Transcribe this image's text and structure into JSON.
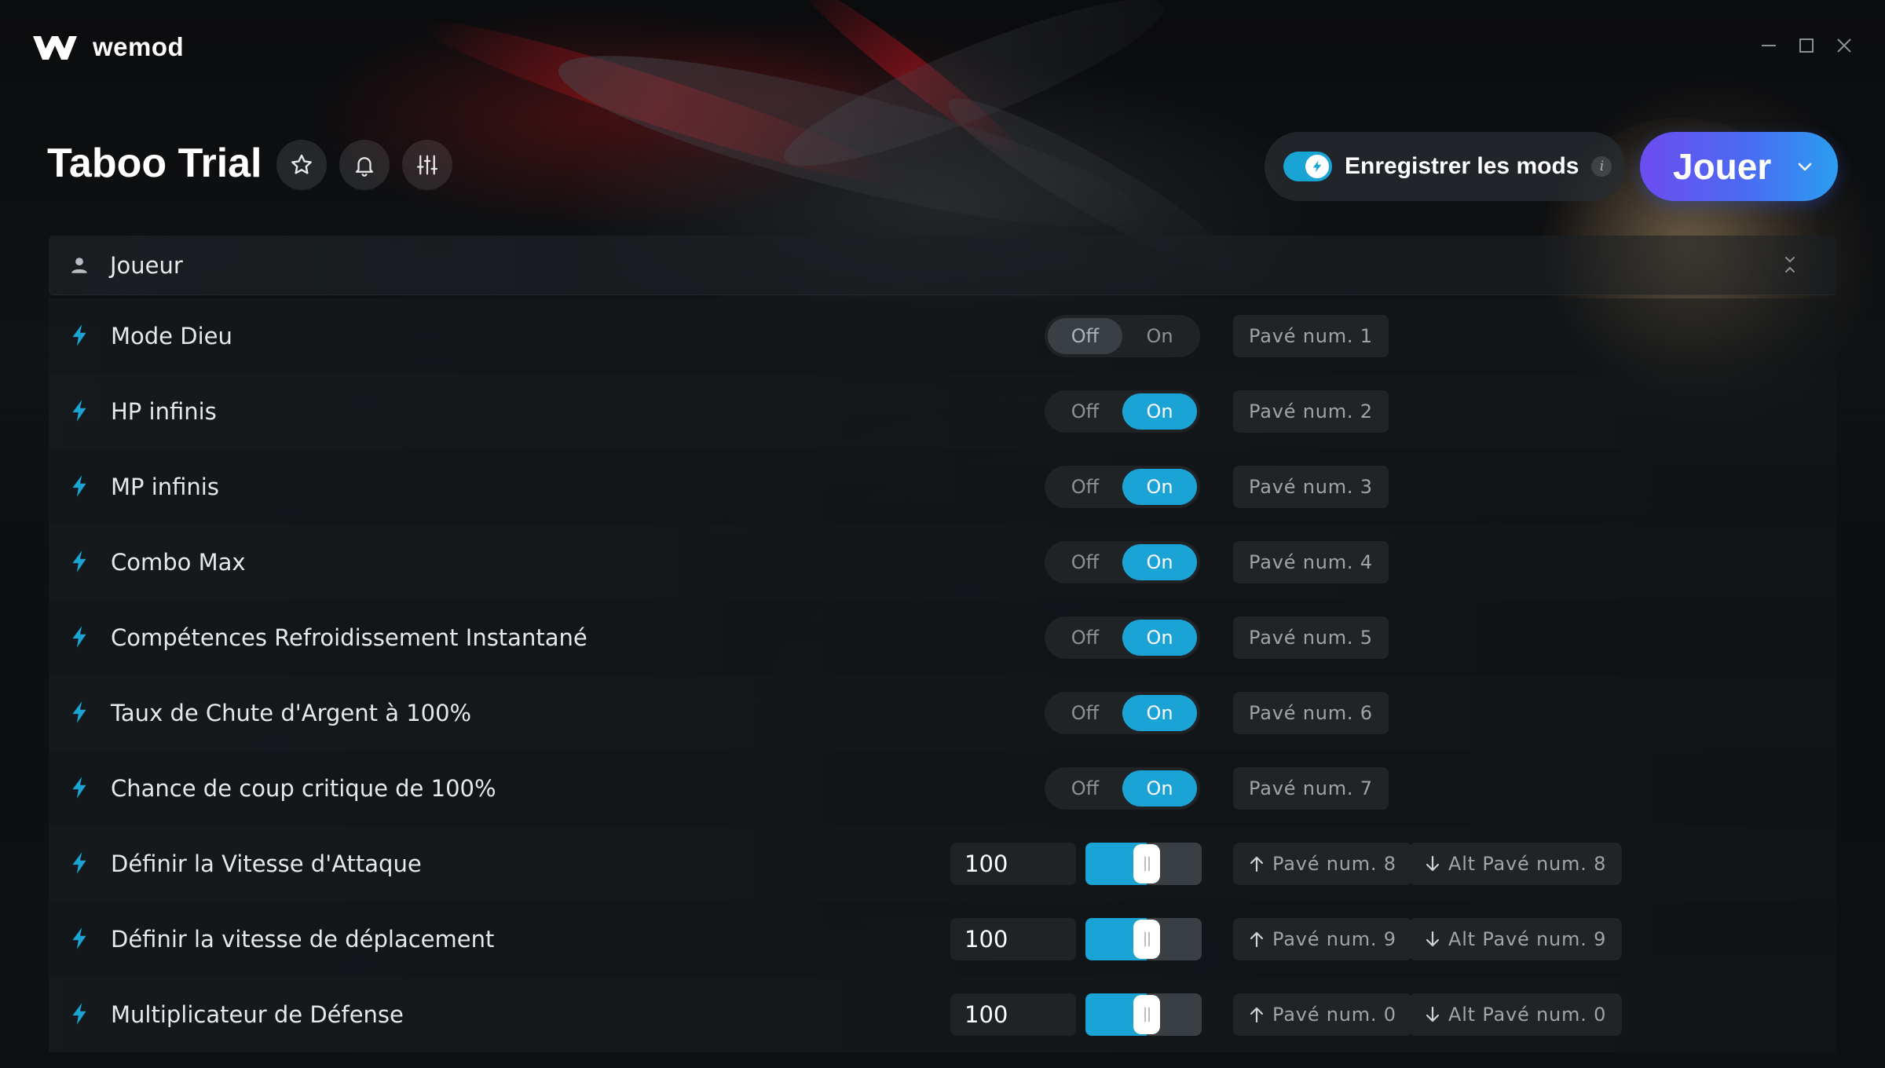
{
  "app": {
    "name": "wemod"
  },
  "header": {
    "game_title": "Taboo Trial",
    "save_mods_label": "Enregistrer les mods",
    "save_mods_enabled": true,
    "info_glyph": "i",
    "play_label": "Jouer"
  },
  "category": {
    "label": "Joueur",
    "icon": "person-icon"
  },
  "mods": [
    {
      "label": "Mode Dieu",
      "type": "toggle",
      "state": "Off",
      "off_label": "Off",
      "on_label": "On",
      "hotkey": "Pavé num. 1"
    },
    {
      "label": "HP infinis",
      "type": "toggle",
      "state": "On",
      "off_label": "Off",
      "on_label": "On",
      "hotkey": "Pavé num. 2"
    },
    {
      "label": "MP infinis",
      "type": "toggle",
      "state": "On",
      "off_label": "Off",
      "on_label": "On",
      "hotkey": "Pavé num. 3"
    },
    {
      "label": "Combo Max",
      "type": "toggle",
      "state": "On",
      "off_label": "Off",
      "on_label": "On",
      "hotkey": "Pavé num. 4"
    },
    {
      "label": "Compétences Refroidissement Instantané",
      "type": "toggle",
      "state": "On",
      "off_label": "Off",
      "on_label": "On",
      "hotkey": "Pavé num. 5"
    },
    {
      "label": "Taux de Chute d'Argent à 100%",
      "type": "toggle",
      "state": "On",
      "off_label": "Off",
      "on_label": "On",
      "hotkey": "Pavé num. 6"
    },
    {
      "label": "Chance de coup critique de 100%",
      "type": "toggle",
      "state": "On",
      "off_label": "Off",
      "on_label": "On",
      "hotkey": "Pavé num. 7"
    },
    {
      "label": "Définir la Vitesse d'Attaque",
      "type": "slider",
      "value": "100",
      "slider_fraction": 0.5,
      "hotkey_up": "Pavé num. 8",
      "hotkey_down": "Alt Pavé num. 8"
    },
    {
      "label": "Définir la vitesse de déplacement",
      "type": "slider",
      "value": "100",
      "slider_fraction": 0.5,
      "hotkey_up": "Pavé num. 9",
      "hotkey_down": "Alt Pavé num. 9"
    },
    {
      "label": "Multiplicateur de Défense",
      "type": "slider",
      "value": "100",
      "slider_fraction": 0.5,
      "hotkey_up": "Pavé num. 0",
      "hotkey_down": "Alt Pavé num. 0"
    }
  ],
  "colors": {
    "accent": "#1aa4d6",
    "play_gradient_start": "#6c4cf0",
    "play_gradient_end": "#2a9ef0"
  }
}
